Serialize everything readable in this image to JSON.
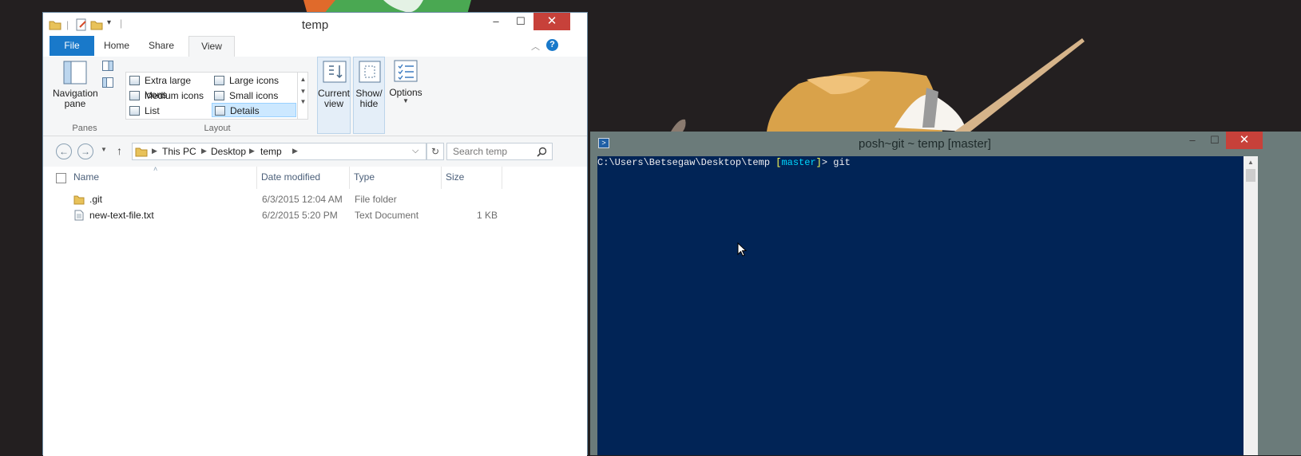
{
  "explorer": {
    "title": "temp",
    "tabs": [
      "File",
      "Home",
      "Share",
      "View"
    ],
    "ribbon": {
      "navigation_pane": [
        "Navigation",
        "pane"
      ],
      "panes_group": "Panes",
      "layout_items": [
        "Extra large icons",
        "Large icons",
        "Medium icons",
        "Small icons",
        "List",
        "Details"
      ],
      "layout_group": "Layout",
      "current_view": [
        "Current",
        "view"
      ],
      "show_hide": [
        "Show/",
        "hide"
      ],
      "options": "Options"
    },
    "breadcrumb": [
      "This PC",
      "Desktop",
      "temp"
    ],
    "search_placeholder": "Search temp",
    "columns": [
      "Name",
      "Date modified",
      "Type",
      "Size"
    ],
    "files": [
      {
        "name": ".git",
        "date": "6/3/2015 12:04 AM",
        "type": "File folder",
        "size": ""
      },
      {
        "name": "new-text-file.txt",
        "date": "6/2/2015 5:20 PM",
        "type": "Text Document",
        "size": "1 KB"
      }
    ]
  },
  "console": {
    "title": "posh~git ~ temp [master]",
    "prompt_path": "C:\\Users\\Betsegaw\\Desktop\\temp ",
    "branch_open": "[",
    "branch": "master",
    "branch_close": "]",
    "prompt_end": "> ",
    "command": "git"
  },
  "colors": {
    "console_bg": "#012456",
    "accent_blue": "#1979ca",
    "close_red": "#c7413a"
  }
}
